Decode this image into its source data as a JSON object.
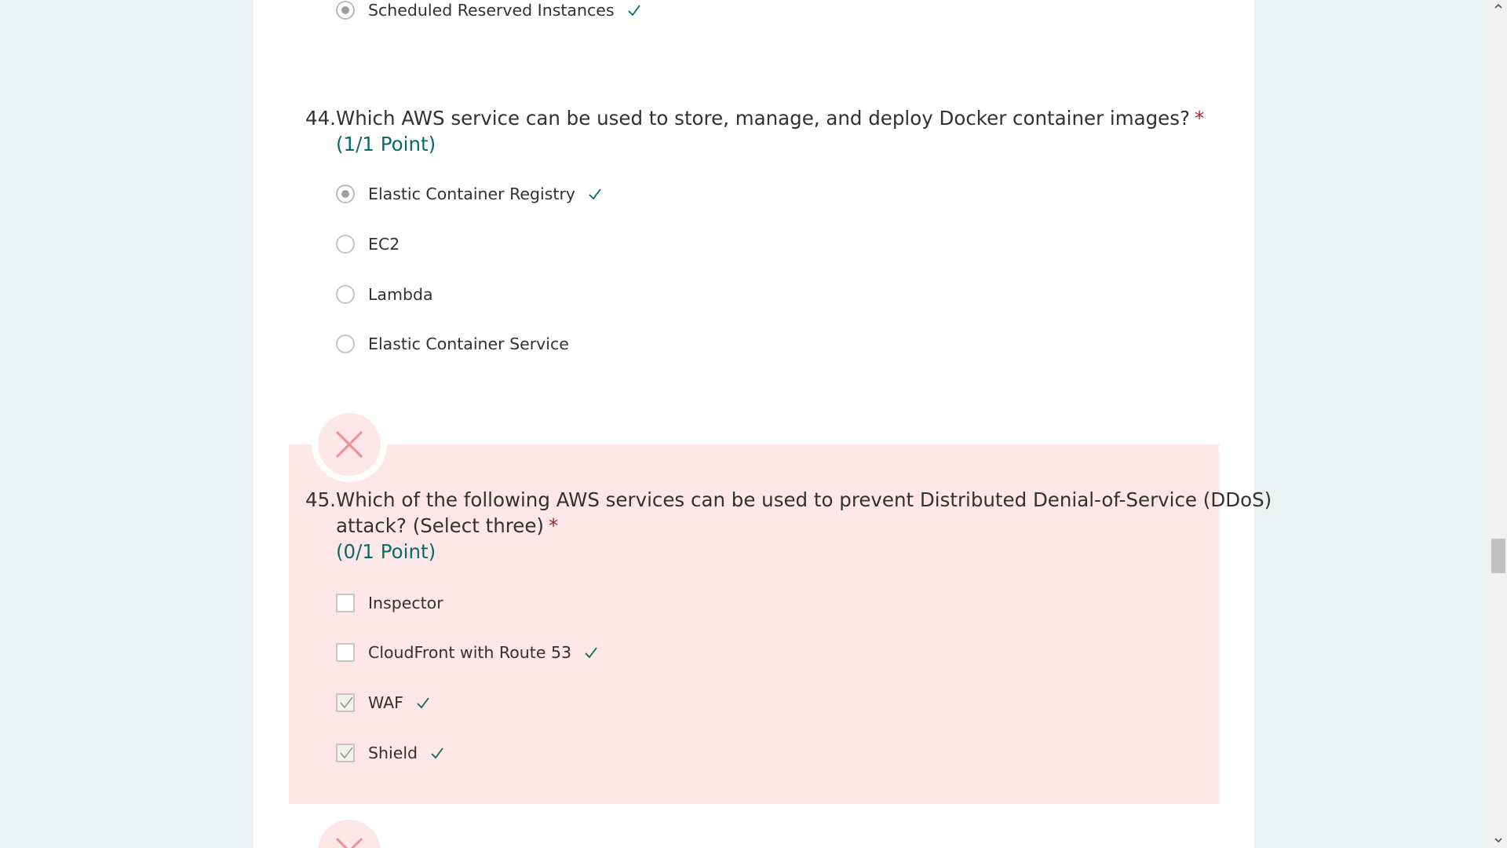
{
  "previous_question": {
    "visible_option": {
      "label": "Scheduled Reserved Instances",
      "selected": true,
      "correct": true
    }
  },
  "q44": {
    "number": "44.",
    "text": "Which AWS service can be used to store, manage, and deploy Docker container images?",
    "required_mark": "*",
    "points": "(1/1 Point)",
    "result": "correct",
    "options": [
      {
        "label": "Elastic Container Registry",
        "selected": true,
        "correct": true
      },
      {
        "label": "EC2",
        "selected": false,
        "correct": false
      },
      {
        "label": "Lambda",
        "selected": false,
        "correct": false
      },
      {
        "label": "Elastic Container Service",
        "selected": false,
        "correct": false
      }
    ]
  },
  "q45": {
    "number": "45.",
    "text_line1": "Which of the following AWS services can be used to prevent Distributed Denial-of-Service (DDoS)",
    "text_line2": "attack? (Select three)",
    "required_mark": "*",
    "points": "(0/1 Point)",
    "result": "incorrect",
    "badge_icon": "close-icon",
    "options": [
      {
        "label": "Inspector",
        "checked": false,
        "correct": false
      },
      {
        "label": "CloudFront with Route 53",
        "checked": false,
        "correct": true
      },
      {
        "label": "WAF",
        "checked": true,
        "correct": true
      },
      {
        "label": "Shield",
        "checked": true,
        "correct": true
      }
    ]
  },
  "colors": {
    "page_background": "#ecf1f1",
    "card_background": "#ffffff",
    "incorrect_panel": "#fde7e9",
    "incorrect_icon": "#f28b91",
    "points_text": "#0b6a63",
    "correct_check": "#0b6a63",
    "required_star": "#a4262c"
  }
}
